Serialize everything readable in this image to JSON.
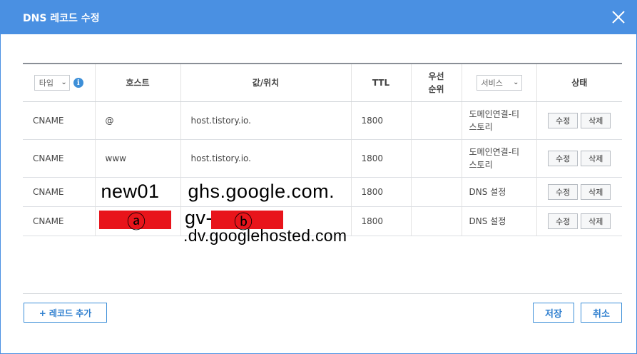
{
  "dialog": {
    "title": "DNS 레코드 수정",
    "close_icon": "close-icon"
  },
  "table": {
    "headers": {
      "type_select": "타입",
      "info_icon": "i",
      "host": "호스트",
      "value": "값/위치",
      "ttl": "TTL",
      "priority": "우선\n순위",
      "service_select": "서비스",
      "status": "상태"
    },
    "rows": [
      {
        "type": "CNAME",
        "host": "@",
        "value": "host.tistory.io.",
        "ttl": "1800",
        "priority": "",
        "service": "도메인연결-티\n스토리",
        "edit": "수정",
        "delete": "삭제"
      },
      {
        "type": "CNAME",
        "host": "www",
        "value": "host.tistory.io.",
        "ttl": "1800",
        "priority": "",
        "service": "도메인연결-티\n스토리",
        "edit": "수정",
        "delete": "삭제"
      },
      {
        "type": "CNAME",
        "host": "new01",
        "value": "ghs.google.com.",
        "ttl": "1800",
        "priority": "",
        "service": "DNS 설정",
        "edit": "수정",
        "delete": "삭제"
      },
      {
        "type": "CNAME",
        "host": "",
        "value": "",
        "ttl": "1800",
        "priority": "",
        "service": "DNS 설정",
        "edit": "수정",
        "delete": "삭제"
      }
    ]
  },
  "annotations": {
    "marker_a": "ⓐ",
    "marker_b": "ⓑ",
    "value_prefix": "gv-",
    "value_suffix": ".dv.googlehosted.com",
    "redaction_color": "#e8141b"
  },
  "footer": {
    "add_record": "+ 레코드 추가",
    "save": "저장",
    "cancel": "취소"
  },
  "colors": {
    "accent": "#4a90e2",
    "button_text": "#2f7fcf"
  }
}
